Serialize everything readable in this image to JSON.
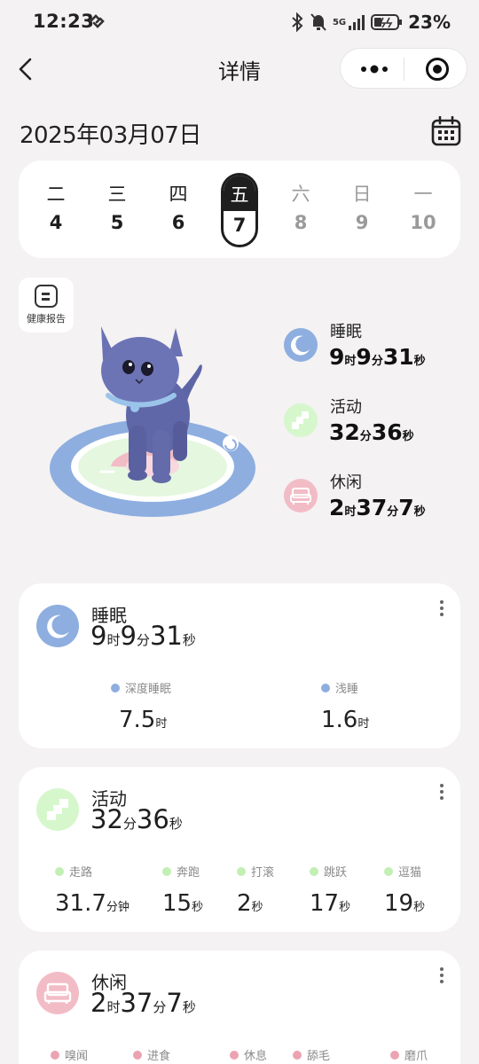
{
  "status_bar": {
    "time": "12:23",
    "network": "5G",
    "battery": "23%"
  },
  "nav": {
    "title": "详情"
  },
  "date": "2025年03月07日",
  "week": [
    {
      "weekday": "二",
      "day": "4",
      "state": "past"
    },
    {
      "weekday": "三",
      "day": "5",
      "state": "past"
    },
    {
      "weekday": "四",
      "day": "6",
      "state": "past"
    },
    {
      "weekday": "五",
      "day": "7",
      "state": "selected"
    },
    {
      "weekday": "六",
      "day": "8",
      "state": "future"
    },
    {
      "weekday": "日",
      "day": "9",
      "state": "future"
    },
    {
      "weekday": "一",
      "day": "10",
      "state": "future"
    }
  ],
  "health_report": {
    "label": "健康报告"
  },
  "summary": {
    "sleep": {
      "name": "睡眠",
      "h": "9",
      "h_unit": "时",
      "m": "9",
      "m_unit": "分",
      "s": "31",
      "s_unit": "秒"
    },
    "activity": {
      "name": "活动",
      "m": "32",
      "m_unit": "分",
      "s": "36",
      "s_unit": "秒"
    },
    "leisure": {
      "name": "休闲",
      "h": "2",
      "h_unit": "时",
      "m": "37",
      "m_unit": "分",
      "s": "7",
      "s_unit": "秒"
    }
  },
  "cards": {
    "sleep": {
      "title": "睡眠",
      "metrics": [
        {
          "label": "深度睡眠",
          "value": "7.5",
          "unit": "时"
        },
        {
          "label": "浅睡",
          "value": "1.6",
          "unit": "时"
        }
      ]
    },
    "activity": {
      "title": "活动",
      "metrics": [
        {
          "label": "走路",
          "value": "31.7",
          "unit": "分钟"
        },
        {
          "label": "奔跑",
          "value": "15",
          "unit": "秒"
        },
        {
          "label": "打滚",
          "value": "2",
          "unit": "秒"
        },
        {
          "label": "跳跃",
          "value": "17",
          "unit": "秒"
        },
        {
          "label": "逗猫",
          "value": "19",
          "unit": "秒"
        }
      ]
    },
    "leisure": {
      "title": "休闲",
      "metrics": [
        {
          "label": "嗅闻"
        },
        {
          "label": "进食"
        },
        {
          "label": "休息"
        },
        {
          "label": "舔毛"
        },
        {
          "label": "磨爪"
        }
      ]
    }
  },
  "colors": {
    "sleep": "#8eaee0",
    "activity": "#d6f7cc",
    "leisure": "#f2bcc6",
    "leisure_dot": "#eca3b1",
    "activity_dot": "#c2efb4"
  },
  "icons": [
    "back-arrow-icon",
    "more-dots-icon",
    "close-target-icon",
    "calendar-icon",
    "moon-zz-icon",
    "activity-squares-icon",
    "sofa-icon",
    "report-icon",
    "cat-illustration"
  ]
}
